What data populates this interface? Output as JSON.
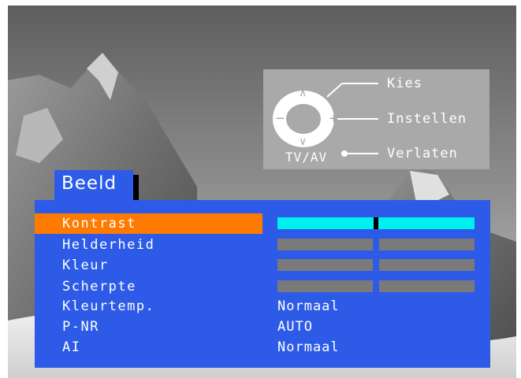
{
  "help": {
    "select_label": "Kies",
    "adjust_label": "Instellen",
    "exit_label": "Verlaten",
    "button_label": "TV/AV"
  },
  "menu": {
    "title": "Beeld",
    "items": [
      {
        "label": "Kontrast",
        "selected": true,
        "level": 0.5
      },
      {
        "label": "Helderheid",
        "level": 0.5
      },
      {
        "label": "Kleur",
        "level": 0.5
      },
      {
        "label": "Scherpte",
        "level": 0.5
      },
      {
        "label": "Kleurtemp.",
        "value": "Normaal"
      },
      {
        "label": "P-NR",
        "value": "AUTO"
      },
      {
        "label": "AI",
        "value": "Normaal"
      }
    ]
  },
  "colors": {
    "menu_bg": "#2d5be8",
    "highlight": "#ff7a00",
    "active_bar": "#00f0f0",
    "inactive_bar": "#7a7a7a"
  },
  "icons": [
    "remote-dpad-icon",
    "up-arrow-icon",
    "down-arrow-icon",
    "minus-icon",
    "plus-icon"
  ]
}
